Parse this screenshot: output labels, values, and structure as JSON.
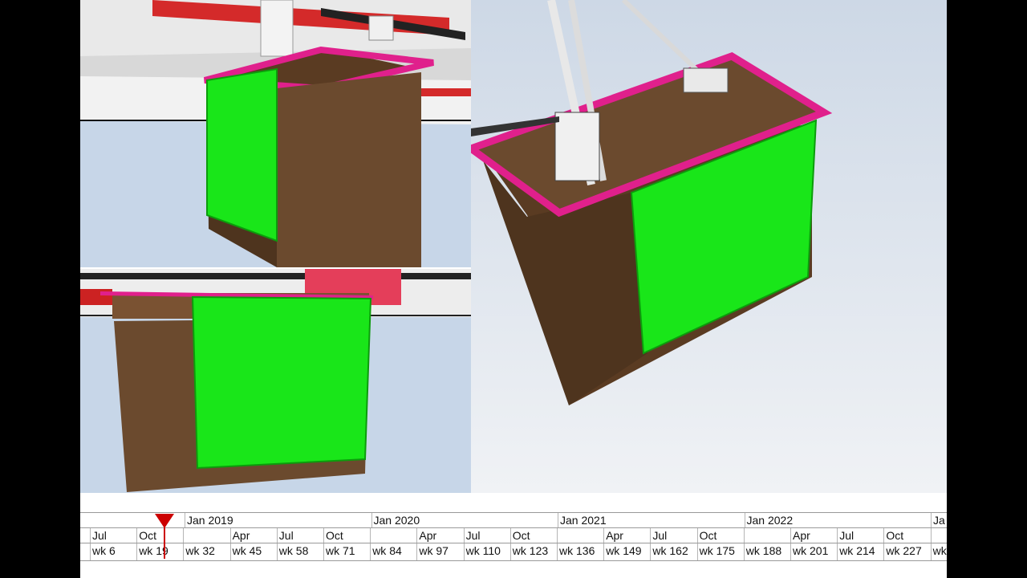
{
  "colors": {
    "sky": "#c6d4e6",
    "block_brown": "#6b4a2e",
    "panel_green": "#19e619",
    "frame_magenta": "#e0208c",
    "beam_red": "#d42a2a",
    "playhead": "#cc0000"
  },
  "viewports": [
    {
      "name": "top-left",
      "view": "3d-model-view"
    },
    {
      "name": "bottom-left",
      "view": "3d-model-view"
    },
    {
      "name": "right",
      "view": "3d-model-view"
    }
  ],
  "timeline": {
    "years": [
      "",
      "Jan 2019",
      "Jan 2020",
      "Jan 2021",
      "Jan 2022",
      "Ja"
    ],
    "months": [
      "Jul",
      "Oct",
      "",
      "Apr",
      "Jul",
      "Oct",
      "",
      "Apr",
      "Jul",
      "Oct",
      "",
      "Apr",
      "Jul",
      "Oct",
      "",
      "Apr",
      "Jul",
      "Oct",
      ""
    ],
    "weeks": [
      "wk 6",
      "wk 19",
      "wk 32",
      "wk 45",
      "wk 58",
      "wk 71",
      "wk 84",
      "wk 97",
      "wk 110",
      "wk 123",
      "wk 136",
      "wk 149",
      "wk 162",
      "wk 175",
      "wk 188",
      "wk 201",
      "wk 214",
      "wk 227",
      "wk"
    ],
    "playhead_week_index": 1
  }
}
